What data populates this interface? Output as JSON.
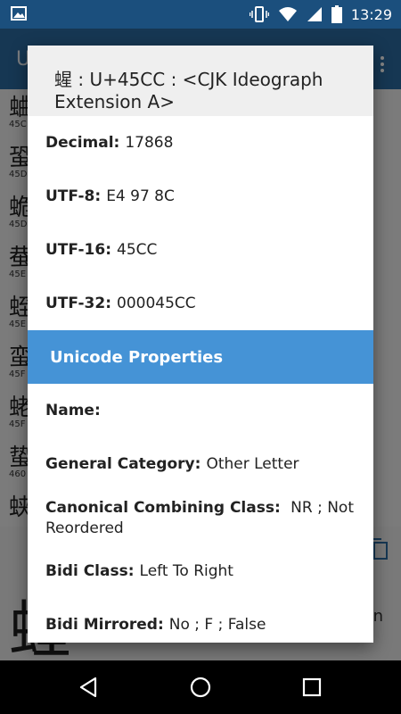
{
  "status_bar": {
    "time": "13:29",
    "icons": [
      "image-icon",
      "vibrate-icon",
      "wifi-icon",
      "signal-icon",
      "battery-icon"
    ]
  },
  "background": {
    "title": "U",
    "rows": [
      {
        "char": "蛐",
        "code": "45C"
      },
      {
        "char": "蛩",
        "code": "45D"
      },
      {
        "char": "蛫",
        "code": "45D"
      },
      {
        "char": "蛬",
        "code": "45E"
      },
      {
        "char": "蛭",
        "code": "45E"
      },
      {
        "char": "蛮",
        "code": "45F"
      },
      {
        "char": "蛯",
        "code": "45F"
      },
      {
        "char": "蛰",
        "code": "460"
      },
      {
        "char": "蛱",
        "code": ""
      }
    ],
    "big_char": "蝗",
    "side_letter": "n"
  },
  "dialog": {
    "title": "䗌 : U+45CC : <CJK Ideograph Extension A>",
    "encodings": [
      {
        "label": "Decimal:",
        "value": "17868"
      },
      {
        "label": "UTF-8:",
        "value": "E4 97 8C"
      },
      {
        "label": "UTF-16:",
        "value": "45CC"
      },
      {
        "label": "UTF-32:",
        "value": "000045CC"
      }
    ],
    "section_title": "Unicode Properties",
    "properties": [
      {
        "label": "Name:",
        "value": ""
      },
      {
        "label": "General Category:",
        "value": "Other Letter"
      },
      {
        "label": "Canonical Combining Class:",
        "value": "NR ; Not Reordered"
      },
      {
        "label": "Bidi Class:",
        "value": "Left To Right"
      },
      {
        "label": "Bidi Mirrored:",
        "value": "No ; F ; False"
      }
    ]
  },
  "nav": {
    "buttons": [
      "back",
      "home",
      "recents"
    ]
  },
  "colors": {
    "status_bar": "#1b4f7d",
    "app_bar": "#2b6aa0",
    "section": "#4593d6",
    "header_bg": "#efefef"
  }
}
